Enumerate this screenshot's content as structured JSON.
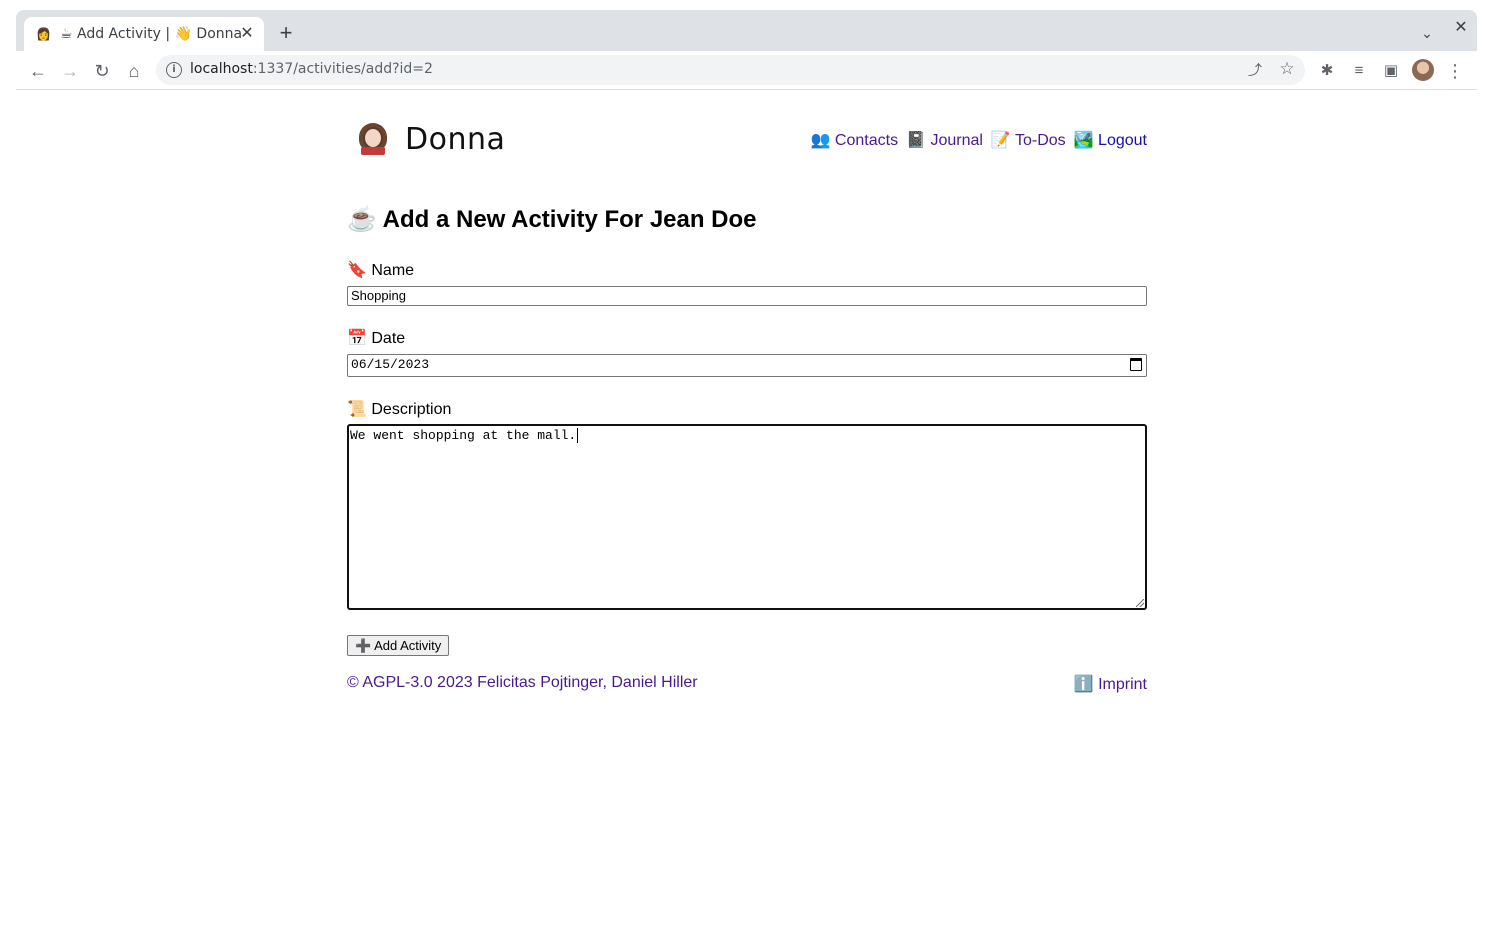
{
  "browser": {
    "tab": {
      "favicon": "👩",
      "title": "☕ Add Activity | 👋 Donna",
      "close_icon": "✕"
    },
    "new_tab_icon": "+",
    "tab_search_icon": "⌄",
    "window_close_icon": "✕",
    "nav": {
      "back_icon": "←",
      "forward_icon": "→",
      "reload_icon": "↻",
      "home_icon": "⌂"
    },
    "omnibox": {
      "info_icon": "i",
      "host": "localhost",
      "path": ":1337/activities/add?id=2",
      "share_icon": "⤴",
      "star_icon": "☆"
    },
    "toolbar_icons": {
      "extensions_icon": "✱",
      "media_icon": "≡",
      "sidepanel_icon": "▣",
      "menu_icon": "⋮"
    }
  },
  "site": {
    "title": "Donna",
    "nav": [
      {
        "label": "👥 Contacts"
      },
      {
        "label": "📓 Journal"
      },
      {
        "label": "📝 To-Dos"
      },
      {
        "label": "🏞️ Logout"
      }
    ]
  },
  "form": {
    "heading": "☕ Add a New Activity For Jean Doe",
    "name_label": "🔖 Name",
    "name_value": "Shopping",
    "date_label": "📅 Date",
    "date_value": "06/15/2023",
    "description_label": "📜 Description",
    "description_value": "We went shopping at the mall.",
    "submit_label": "➕ Add Activity"
  },
  "footer": {
    "copyright": "© AGPL-3.0 2023 Felicitas Pojtinger, Daniel Hiller",
    "imprint": "ℹ️ Imprint"
  }
}
